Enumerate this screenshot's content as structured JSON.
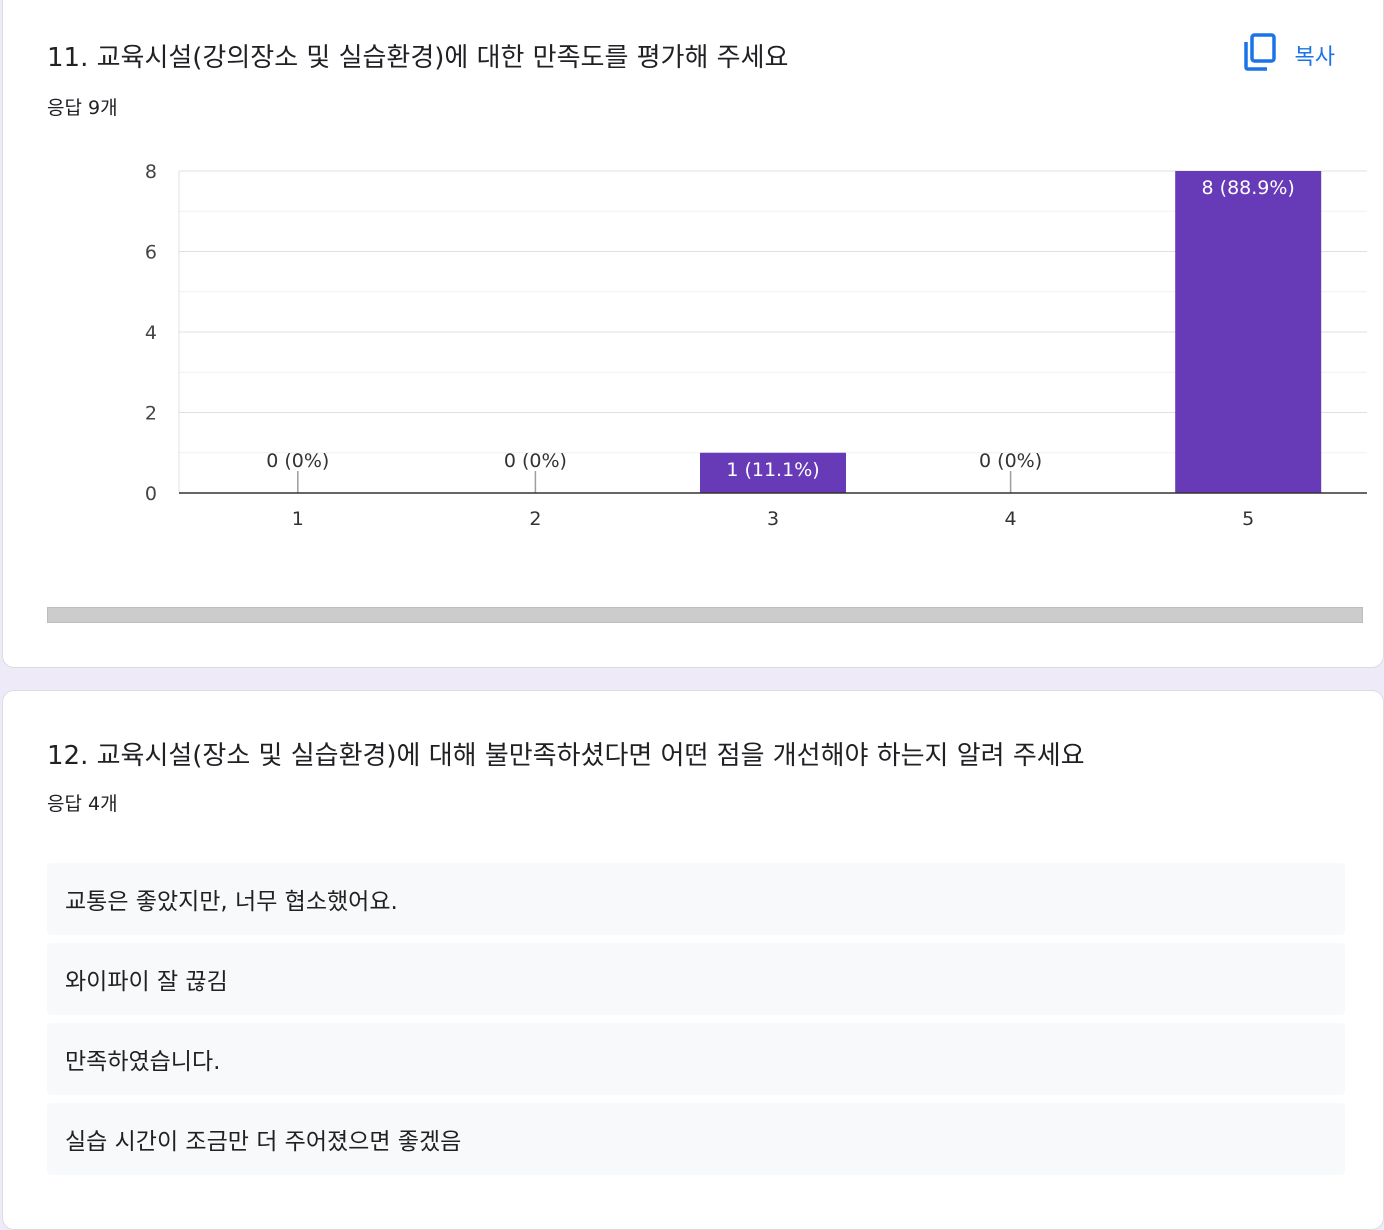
{
  "questions": [
    {
      "title": "11. 교육시설(강의장소 및 실습환경)에 대한 만족도를 평가해 주세요",
      "response_count": "응답 9개",
      "copy_label": "복사"
    },
    {
      "title": "12. 교육시설(장소 및 실습환경)에 대해 불만족하셨다면 어떤 점을 개선해야 하는지 알려 주세요",
      "response_count": "응답 4개",
      "responses": [
        "교통은 좋았지만, 너무 협소했어요.",
        "와이파이 잘 끊김",
        "만족하였습니다.",
        "실습 시간이 조금만 더 주어졌으면 좋겠음"
      ]
    }
  ],
  "colors": {
    "bar": "#673ab7",
    "accent": "#1a73e8",
    "background": "#efeaf8"
  },
  "chart_data": {
    "type": "bar",
    "categories": [
      "1",
      "2",
      "3",
      "4",
      "5"
    ],
    "values": [
      0,
      0,
      1,
      0,
      8
    ],
    "data_labels": [
      "0 (0%)",
      "0 (0%)",
      "1 (11.1%)",
      "0 (0%)",
      "8 (88.9%)"
    ],
    "ylim": [
      0,
      8
    ],
    "yticks": [
      0,
      2,
      4,
      6,
      8
    ],
    "grid": true,
    "title": "",
    "xlabel": "",
    "ylabel": ""
  }
}
